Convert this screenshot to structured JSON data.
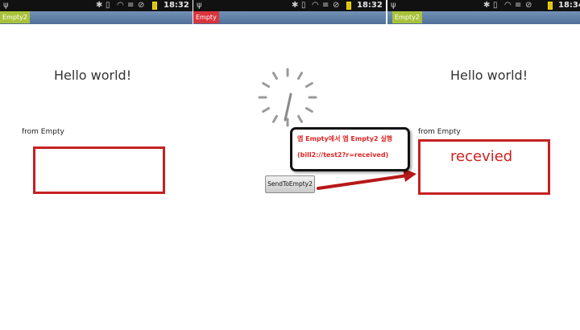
{
  "screens": [
    {
      "time": "18:32",
      "app_tab": "Empty2",
      "app_tab_color": "#a8c23a",
      "heading": "Hello world!",
      "from_label": "from Empty",
      "received_value": ""
    },
    {
      "time": "18:32",
      "app_tab": "Empty",
      "app_tab_color": "#d9353c",
      "button_label": "SendToEmpty2"
    },
    {
      "time": "18:34",
      "app_tab": "Empty2",
      "app_tab_color": "#a8c23a",
      "heading": "Hello world!",
      "from_label": "from Empty",
      "received_value": "recevied"
    }
  ],
  "annotation": {
    "line1_prefix": "앱 ",
    "line1_app1": "Empty",
    "line1_mid": "에서 앱 ",
    "line1_app2": "Empty2",
    "line1_suffix": " 실행",
    "line2": "(bill2://test2?r=received)",
    "text_color": "#e02525",
    "arrow_color": "#d42020"
  },
  "icons": [
    "usb-icon",
    "bluetooth-icon",
    "vibrate-icon",
    "signal-icon",
    "wifi-icon",
    "no-service-icon",
    "battery-icon",
    "loading-spinner-icon",
    "arrow-icon"
  ]
}
